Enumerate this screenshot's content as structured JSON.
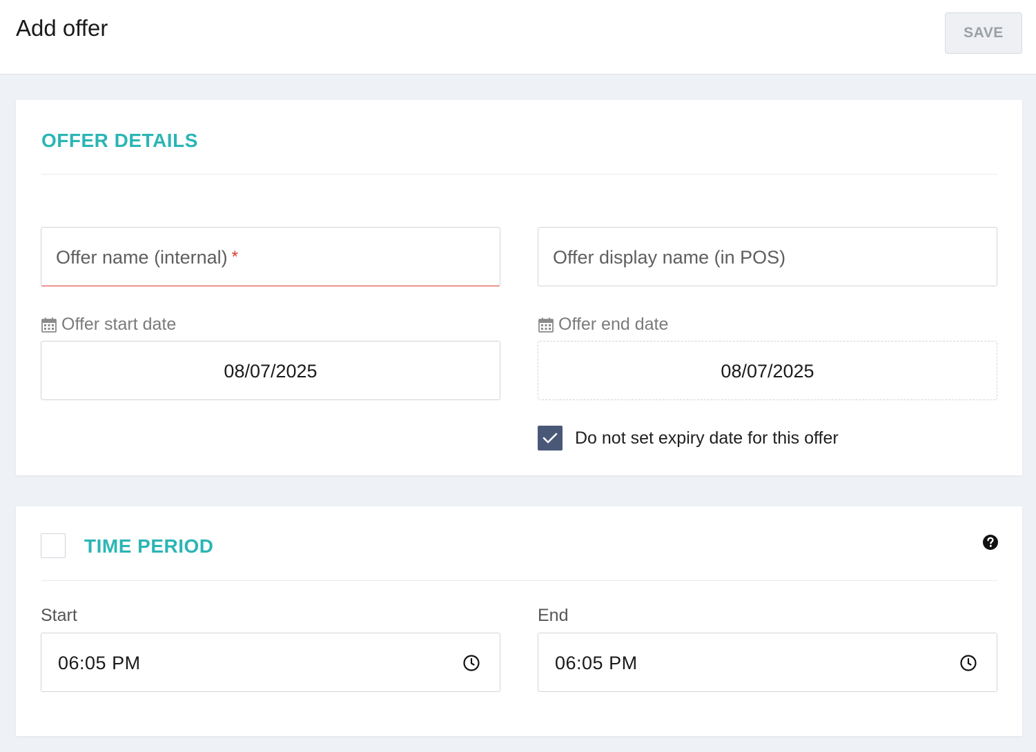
{
  "header": {
    "title": "Add offer",
    "save_label": "SAVE"
  },
  "offer_details": {
    "title": "OFFER DETAILS",
    "name_placeholder": "Offer name (internal)",
    "required_marker": "*",
    "display_name_placeholder": "Offer display name (in POS)",
    "start_date_label": "Offer start date",
    "start_date_value": "08/07/2025",
    "end_date_label": "Offer end date",
    "end_date_value": "08/07/2025",
    "no_expiry_label": "Do not set expiry date for this offer",
    "no_expiry_checked": true
  },
  "time_period": {
    "title": "TIME PERIOD",
    "enabled": false,
    "start_label": "Start",
    "start_value": "06:05  PM",
    "end_label": "End",
    "end_value": "06:05  PM"
  },
  "colors": {
    "accent": "#2bb5b5",
    "checkbox": "#4a5878",
    "required": "#d9382c"
  },
  "icons": [
    "calendar-icon",
    "check-icon",
    "help-icon",
    "clock-icon"
  ]
}
